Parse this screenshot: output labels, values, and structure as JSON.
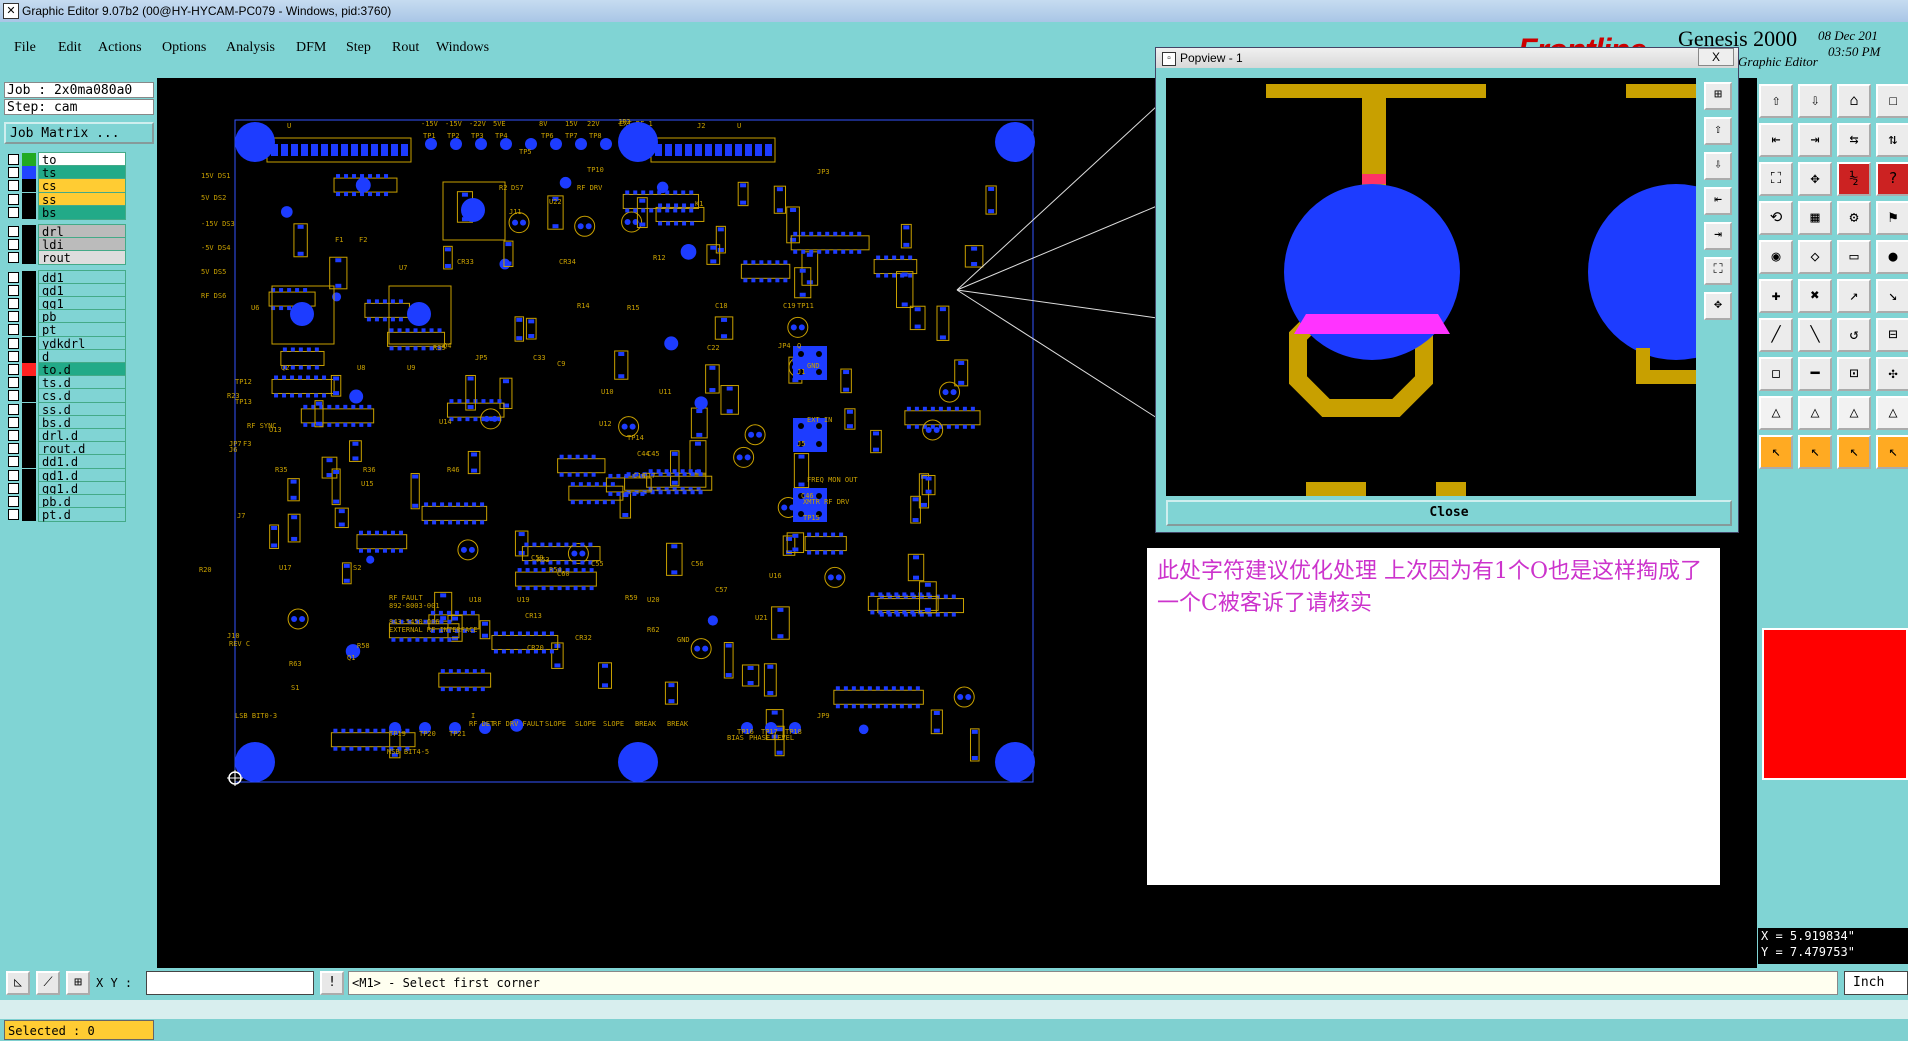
{
  "window": {
    "title": "Graphic Editor 9.07b2 (00@HY-HYCAM-PC079 - Windows, pid:3760)"
  },
  "menu": [
    "File",
    "Edit",
    "Actions",
    "Options",
    "Analysis",
    "DFM",
    "Step",
    "Rout",
    "Windows"
  ],
  "brand": {
    "logo": "Frontline",
    "product": "Genesis 2000",
    "subtitle": "Graphic Editor",
    "date": "08 Dec 201",
    "time": "03:50 PM"
  },
  "job": {
    "job_line": "Job : 2x0ma080a0",
    "step_line": "Step: cam",
    "matrix_button": "Job Matrix ..."
  },
  "layers": [
    {
      "name": "to",
      "color": "#22aa22",
      "bg": "#ffffff"
    },
    {
      "name": "ts",
      "color": "#2244ff",
      "bg": "#22aa88"
    },
    {
      "name": "cs",
      "color": "#000000",
      "bg": "#ffcc33"
    },
    {
      "name": "ss",
      "color": "#000000",
      "bg": "#ffcc33"
    },
    {
      "name": "bs",
      "color": "#000000",
      "bg": "#22aa88"
    },
    {
      "name": "drl",
      "color": "#000000",
      "bg": "#bbbbbb"
    },
    {
      "name": "ldi",
      "color": "#000000",
      "bg": "#bbbbbb"
    },
    {
      "name": "rout",
      "color": "#000000",
      "bg": "#dddddd"
    },
    {
      "name": "dd1",
      "color": "#000000",
      "bg": "#80d4d4"
    },
    {
      "name": "gd1",
      "color": "#000000",
      "bg": "#80d4d4"
    },
    {
      "name": "gg1",
      "color": "#000000",
      "bg": "#80d4d4"
    },
    {
      "name": "pb",
      "color": "#000000",
      "bg": "#80d4d4"
    },
    {
      "name": "pt",
      "color": "#000000",
      "bg": "#80d4d4"
    },
    {
      "name": "ydkdrl",
      "color": "#000000",
      "bg": "#80d4d4"
    },
    {
      "name": "d",
      "color": "#000000",
      "bg": "#80d4d4"
    },
    {
      "name": "to.d",
      "color": "#ff2222",
      "bg": "#22aa88"
    },
    {
      "name": "ts.d",
      "color": "#000000",
      "bg": "#80d4d4"
    },
    {
      "name": "cs.d",
      "color": "#000000",
      "bg": "#80d4d4"
    },
    {
      "name": "ss.d",
      "color": "#000000",
      "bg": "#80d4d4"
    },
    {
      "name": "bs.d",
      "color": "#000000",
      "bg": "#80d4d4"
    },
    {
      "name": "drl.d",
      "color": "#000000",
      "bg": "#80d4d4"
    },
    {
      "name": "rout.d",
      "color": "#000000",
      "bg": "#80d4d4"
    },
    {
      "name": "dd1.d",
      "color": "#000000",
      "bg": "#80d4d4"
    },
    {
      "name": "gd1.d",
      "color": "#000000",
      "bg": "#80d4d4"
    },
    {
      "name": "gg1.d",
      "color": "#000000",
      "bg": "#80d4d4"
    },
    {
      "name": "pb.d",
      "color": "#000000",
      "bg": "#80d4d4"
    },
    {
      "name": "pt.d",
      "color": "#000000",
      "bg": "#80d4d4"
    }
  ],
  "selected": "Selected : 0",
  "coords": {
    "x": "X = 5.919834\"",
    "y": "Y = 7.479753\""
  },
  "bottom": {
    "xy_label": "X Y :",
    "xy_value": "",
    "prompt": "<M1> - Select first corner",
    "units": "Inch"
  },
  "popview": {
    "title": "Popview - 1",
    "close_label": "Close",
    "x_label": "X"
  },
  "note": {
    "text": "此处字符建议优化处理  上次因为有1个O也是这样掏成了一个C被客诉了请核实"
  },
  "board": {
    "labels": [
      "U",
      "J2",
      "U",
      "JP1",
      "JP2",
      "JP3",
      "JP4",
      "JP5",
      "JP7",
      "JP9",
      "-15V",
      "-15V",
      "-22V",
      "5VE",
      "8V",
      "15V",
      "22V",
      "EXT RF 1",
      "TP1",
      "TP2",
      "TP3",
      "TP4",
      "TP5",
      "TP6",
      "TP7",
      "TP8",
      "TP9",
      "TP10",
      "TP11",
      "TP12",
      "TP13",
      "TP14",
      "TP15",
      "TP16",
      "TP17",
      "TP18",
      "TP19",
      "TP20",
      "TP21",
      "15V DS1",
      "5V DS2",
      "-15V DS3",
      "-5V DS4",
      "5V DS5",
      "RF DS6",
      "U6",
      "U7",
      "U8",
      "U9",
      "U10",
      "U11",
      "U12",
      "U13",
      "U14",
      "U15",
      "U16",
      "U17",
      "U18",
      "U19",
      "U20",
      "U21",
      "U22",
      "J1",
      "J5",
      "J6",
      "J7",
      "J10",
      "J11",
      "K1",
      "Q1",
      "Q2",
      "Q4",
      "CR13",
      "CR20",
      "CR32",
      "CR33",
      "CR34",
      "C9",
      "C16",
      "C17",
      "C18",
      "C19",
      "C22",
      "C33",
      "C44",
      "C45",
      "C46",
      "C55",
      "C56",
      "C57",
      "C59",
      "C60",
      "R2",
      "R12",
      "R14",
      "R15",
      "R20",
      "R23",
      "R35",
      "R36",
      "R39",
      "R46",
      "R53",
      "R54",
      "R58",
      "R59",
      "R62",
      "R63",
      "S1",
      "S2",
      "DS7",
      "F1",
      "F2",
      "F3",
      "GND",
      "EXT IN",
      "FREQ MON OUT",
      "XMTR RF DRV",
      "RF DRV",
      "RF SYNC",
      "RF FAULT",
      "892-8003-001",
      "843-5450-006",
      "EXTERNAL RF INTERFACE",
      "REV C",
      "LSB BIT0-3",
      "MSB BIT4-5",
      "RF DET",
      "RF DRV FAULT",
      "SLOPE",
      "SLOPE",
      "SLOPE",
      "BREAK",
      "BREAK",
      "BIAS",
      "PHASE",
      "LEVEL",
      "I",
      "Q",
      "GND",
      "NOR",
      "20K",
      "NIT OUT"
    ]
  }
}
